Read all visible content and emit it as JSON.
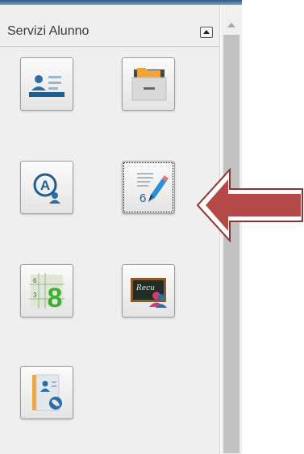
{
  "panel": {
    "title": "Servizi Alunno"
  },
  "colors": {
    "arrow_fill": "#b44a47",
    "arrow_border": "#8e3532",
    "accent_blue": "#2e6da4",
    "accent_green": "#4cae4c"
  },
  "tiles": [
    {
      "name": "student-registry-tile",
      "icon": "id-card-icon",
      "row": 1,
      "col": 1
    },
    {
      "name": "documents-archive-tile",
      "icon": "file-drawer-icon",
      "row": 1,
      "col": 2
    },
    {
      "name": "attendance-tile",
      "icon": "letter-a-user-icon",
      "row": 2,
      "col": 1
    },
    {
      "name": "grades-entry-tile",
      "icon": "pencil-grade-icon",
      "row": 2,
      "col": 2,
      "focused": true
    },
    {
      "name": "grade-summary-tile",
      "icon": "grade-grid-icon",
      "row": 3,
      "col": 1,
      "label": "8",
      "sub_labels": [
        "6",
        "3"
      ]
    },
    {
      "name": "recovery-tile",
      "icon": "blackboard-user-icon",
      "row": 3,
      "col": 2,
      "label": "Recu"
    },
    {
      "name": "online-profile-tile",
      "icon": "contact-globe-icon",
      "row": 4,
      "col": 1
    }
  ],
  "grades_tile": {
    "number": "6"
  }
}
